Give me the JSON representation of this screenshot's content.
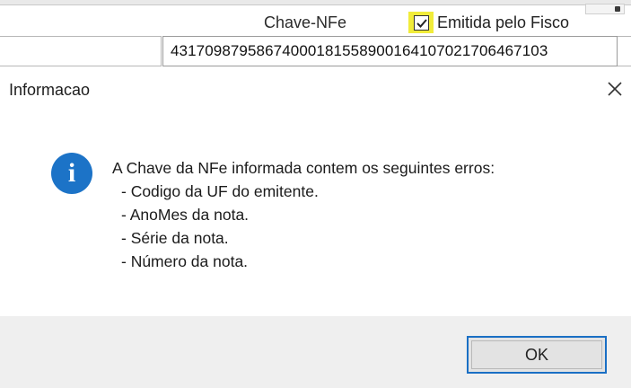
{
  "background_form": {
    "column_header": "Chave-NFe",
    "checkbox": {
      "label": "Emitida pelo Fisco",
      "checked": true,
      "highlight_color": "#f1ec3a"
    },
    "key_value": "43170987958674000181558900164107021706467103"
  },
  "dialog": {
    "title": "Informacao",
    "icon": "info-icon",
    "icon_color": "#1c73c7",
    "message_header": "A Chave da NFe informada contem os seguintes erros:",
    "errors": [
      "- Codigo da UF do emitente.",
      "- AnoMes da nota.",
      "- Série da nota.",
      "- Número da nota."
    ],
    "ok_label": "OK",
    "accent_color": "#1a6fc4"
  }
}
